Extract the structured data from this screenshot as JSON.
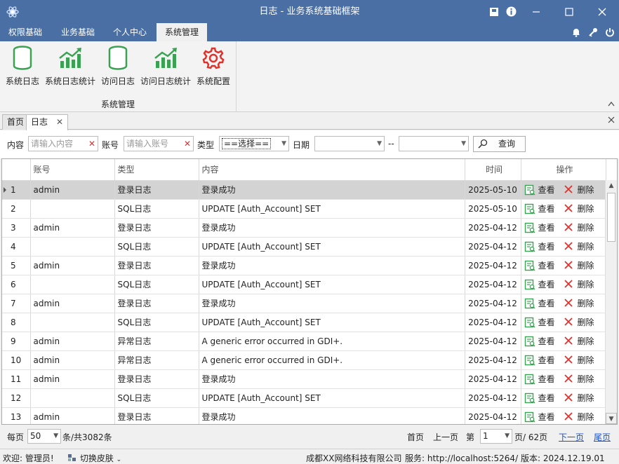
{
  "window": {
    "title": "日志 - 业务系统基础框架"
  },
  "menu": {
    "tabs": [
      "权限基础",
      "业务基础",
      "个人中心",
      "系统管理"
    ]
  },
  "ribbon": {
    "buttons": [
      "系统日志",
      "系统日志统计",
      "访问日志",
      "访问日志统计",
      "系统配置"
    ],
    "group_label": "系统管理"
  },
  "doc_tabs": {
    "home": "首页",
    "log": "日志"
  },
  "filter": {
    "content_label": "内容",
    "content_placeholder": "请输入内容",
    "account_label": "账号",
    "account_placeholder": "请输入账号",
    "type_label": "类型",
    "type_value": "==选择==",
    "date_label": "日期",
    "date_sep": "--",
    "query_button": "查询"
  },
  "grid": {
    "columns": {
      "account": "账号",
      "type": "类型",
      "content": "内容",
      "time": "时间",
      "ops": "操作"
    },
    "op_view": "查看",
    "op_delete": "删除",
    "rows": [
      {
        "no": "1",
        "account": "admin",
        "type": "登录日志",
        "content": "登录成功",
        "time": "2025-05-10"
      },
      {
        "no": "2",
        "account": "",
        "type": "SQL日志",
        "content": "UPDATE [Auth_Account]  SET",
        "time": "2025-05-10"
      },
      {
        "no": "3",
        "account": "admin",
        "type": "登录日志",
        "content": "登录成功",
        "time": "2025-04-12"
      },
      {
        "no": "4",
        "account": "",
        "type": "SQL日志",
        "content": "UPDATE [Auth_Account]  SET",
        "time": "2025-04-12"
      },
      {
        "no": "5",
        "account": "admin",
        "type": "登录日志",
        "content": "登录成功",
        "time": "2025-04-12"
      },
      {
        "no": "6",
        "account": "",
        "type": "SQL日志",
        "content": "UPDATE [Auth_Account]  SET",
        "time": "2025-04-12"
      },
      {
        "no": "7",
        "account": "admin",
        "type": "登录日志",
        "content": "登录成功",
        "time": "2025-04-12"
      },
      {
        "no": "8",
        "account": "",
        "type": "SQL日志",
        "content": "UPDATE [Auth_Account]  SET",
        "time": "2025-04-12"
      },
      {
        "no": "9",
        "account": "admin",
        "type": "异常日志",
        "content": "A generic error occurred in GDI+.",
        "time": "2025-04-12"
      },
      {
        "no": "10",
        "account": "admin",
        "type": "异常日志",
        "content": "A generic error occurred in GDI+.",
        "time": "2025-04-12"
      },
      {
        "no": "11",
        "account": "admin",
        "type": "登录日志",
        "content": "登录成功",
        "time": "2025-04-12"
      },
      {
        "no": "12",
        "account": "",
        "type": "SQL日志",
        "content": "UPDATE [Auth_Account]  SET",
        "time": "2025-04-12"
      },
      {
        "no": "13",
        "account": "admin",
        "type": "登录日志",
        "content": "登录成功",
        "time": "2025-04-12"
      }
    ]
  },
  "pager": {
    "per_page_label": "每页",
    "per_page_value": "50",
    "total_text": "条/共3082条",
    "first": "首页",
    "prev": "上一页",
    "page_label": "第",
    "page_value": "1",
    "pages_text": "页/ 62页",
    "next": "下一页",
    "last": "尾页"
  },
  "status": {
    "welcome": "欢迎: 管理员!",
    "skin": "切换皮肤",
    "company": "成都XX网络科技有限公司",
    "service": "服务: http://localhost:5264/",
    "version": "版本: 2024.12.19.01"
  },
  "colors": {
    "titlebar": "#4a6fa5",
    "link": "#1a52c6",
    "selected_row": "#d3d3d3",
    "ribbon_green": "#3aa353",
    "gear_red": "#e0322d"
  }
}
